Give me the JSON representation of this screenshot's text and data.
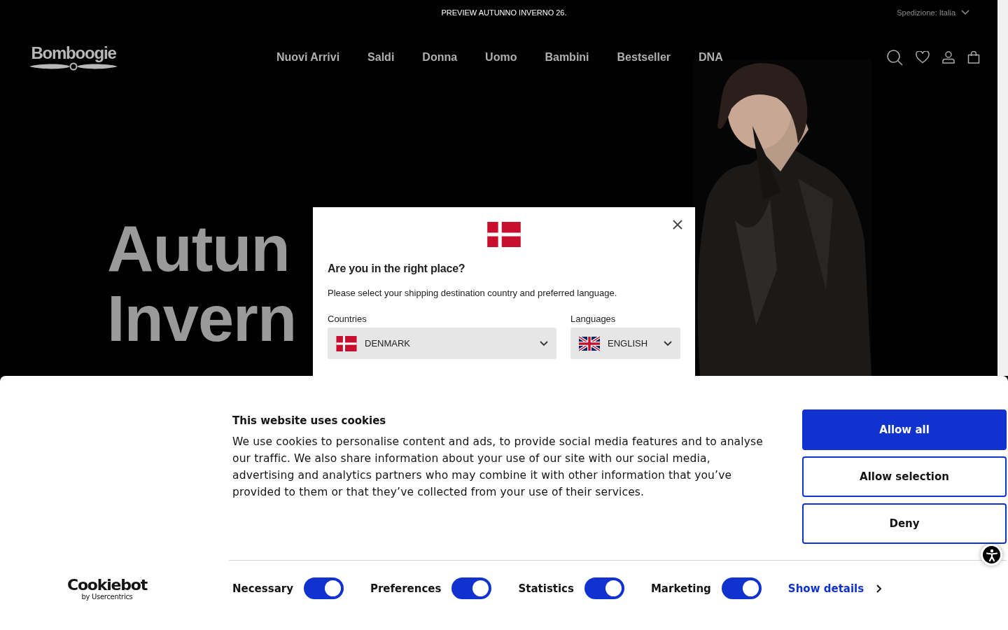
{
  "announcement": "PREVIEW AUTUNNO INVERNO 26.",
  "shipping": {
    "label": "Spedizione: Italia"
  },
  "logo": {
    "text": "Bomboogie"
  },
  "nav": [
    {
      "label": "Nuovi Arrivi"
    },
    {
      "label": "Saldi"
    },
    {
      "label": "Donna"
    },
    {
      "label": "Uomo"
    },
    {
      "label": "Bambini"
    },
    {
      "label": "Bestseller"
    },
    {
      "label": "DNA"
    }
  ],
  "hero": {
    "title_lines": [
      "Autun",
      "Invern"
    ],
    "image": {
      "kind": "picture"
    }
  },
  "locale_modal": {
    "title": "Are you in the right place?",
    "text": "Please select your shipping destination country and preferred language.",
    "country": {
      "label": "Countries",
      "value": "DENMARK",
      "kind": "dk"
    },
    "language": {
      "label": "Languages",
      "value": "ENGLISH",
      "kind": "gb"
    }
  },
  "cookie_banner": {
    "title": "This website uses cookies",
    "text": "We use cookies to personalise content and ads, to provide social media features and to analyse our traffic. We also share information about your use of our site with our social media, advertising and analytics partners who may combine it with other information that you’ve provided to them or that they’ve collected from your use of their services.",
    "buttons": [
      {
        "label": "Allow all",
        "kind": "primary"
      },
      {
        "label": "Allow selection",
        "kind": "outline"
      },
      {
        "label": "Deny",
        "kind": "outline"
      }
    ],
    "toggles": [
      {
        "label": "Necessary",
        "on": true
      },
      {
        "label": "Preferences",
        "on": true
      },
      {
        "label": "Statistics",
        "on": true
      },
      {
        "label": "Marketing",
        "on": true
      }
    ],
    "details_link": "Show details",
    "brand": {
      "name": "Cookiebot",
      "byline": "by Usercentrics"
    }
  }
}
